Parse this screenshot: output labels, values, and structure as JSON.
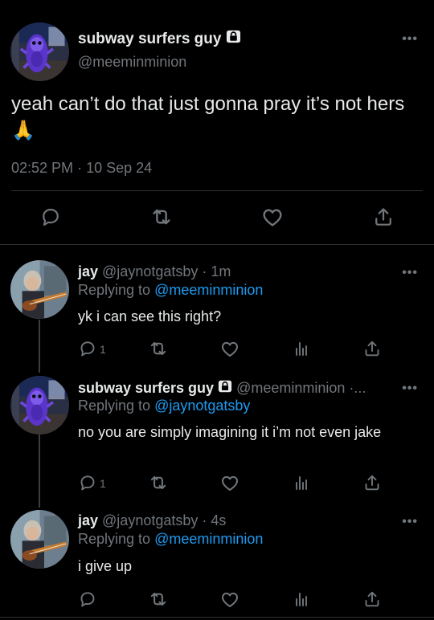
{
  "main": {
    "name": "subway surfers guy",
    "handle": "@meeminminion",
    "text": "yeah can’t do that just gonna pray it’s not hers 🙏",
    "time": "02:52 PM",
    "sep": "·",
    "date": "10 Sep 24",
    "more": "•••"
  },
  "icons": [
    "lock-icon",
    "reply-icon",
    "retweet-icon",
    "like-icon",
    "share-icon",
    "analytics-icon",
    "more-icon"
  ],
  "replies": [
    {
      "name": "jay",
      "handle": "@jaynotgatsby",
      "time": "· 1m",
      "replying_prefix": "Replying to",
      "replying_to": "@meeminminion",
      "text": "yk i can see this right?",
      "reply_count": "1",
      "more": "•••"
    },
    {
      "name": "subway surfers guy",
      "handle": "@meeminminion",
      "time": "·...",
      "replying_prefix": "Replying to",
      "replying_to": "@jaynotgatsby",
      "text": "no you are simply imagining it i’m not even jake",
      "reply_count": "1",
      "more": "•••"
    },
    {
      "name": "jay",
      "handle": "@jaynotgatsby",
      "time": "· 4s",
      "replying_prefix": "Replying to",
      "replying_to": "@meeminminion",
      "text": "i give up",
      "reply_count": "",
      "more": "•••"
    }
  ],
  "colors": {
    "background": "#000000",
    "text": "#e7e9ea",
    "muted": "#71767b",
    "link": "#1d9bf0",
    "border": "#2f3336"
  }
}
